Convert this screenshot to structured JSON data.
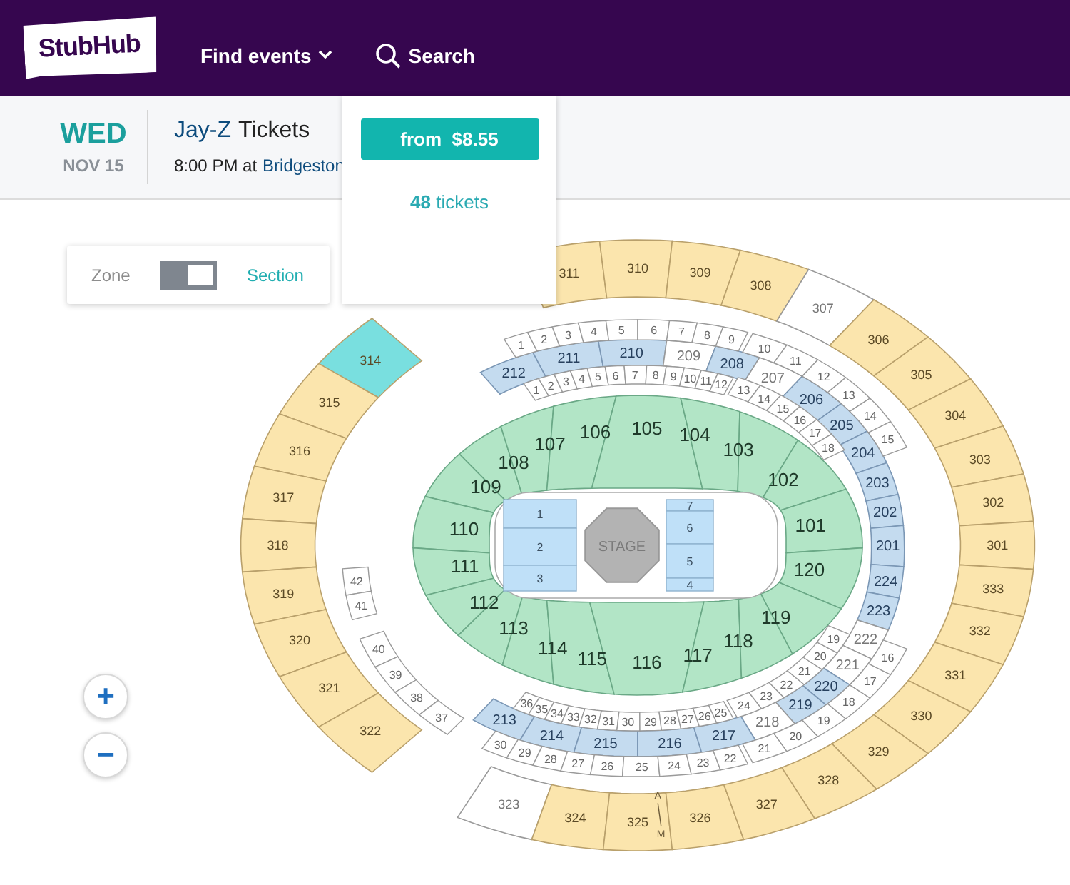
{
  "header": {
    "logo": "StubHub",
    "nav": [
      {
        "label": "Find events",
        "kind": "dropdown"
      },
      {
        "label": "Search",
        "kind": "search"
      }
    ]
  },
  "event": {
    "weekday": "WED",
    "date": "NOV 15",
    "artist": "Jay-Z",
    "title_suffix": "Tickets",
    "time_prefix": "8:00 PM at",
    "venue": "Bridgeston"
  },
  "popover": {
    "price_prefix": "from",
    "price": "$8.55",
    "tickets": "**48** tickets"
  },
  "view_toggle": {
    "left": "Zone",
    "right": "Section",
    "on": true
  },
  "zoom": [
    "+",
    "−"
  ],
  "map": {
    "upper_level": {
      "top": [
        {
          "label": "311",
          "available": true,
          "selected": false
        },
        {
          "label": "310",
          "available": true,
          "selected": false
        },
        {
          "label": "309",
          "available": true,
          "selected": false
        },
        {
          "label": "308",
          "available": true,
          "selected": false
        }
      ],
      "left": [
        {
          "label": "314",
          "available": true,
          "selected": true
        },
        {
          "label": "315",
          "available": true,
          "selected": false
        },
        {
          "label": "316",
          "available": true,
          "selected": false
        },
        {
          "label": "317",
          "available": true,
          "selected": false
        },
        {
          "label": "318",
          "available": true,
          "selected": false
        },
        {
          "label": "319",
          "available": true,
          "selected": false
        },
        {
          "label": "320",
          "available": true,
          "selected": false
        },
        {
          "label": "321",
          "available": true,
          "selected": false
        },
        {
          "label": "322",
          "available": true,
          "selected": false
        }
      ],
      "right": [
        {
          "label": "307",
          "available": false,
          "selected": false
        },
        {
          "label": "306",
          "available": true,
          "selected": false
        },
        {
          "label": "305",
          "available": true,
          "selected": false
        },
        {
          "label": "304",
          "available": true,
          "selected": false
        },
        {
          "label": "303",
          "available": true,
          "selected": false
        },
        {
          "label": "302",
          "available": true,
          "selected": false
        },
        {
          "label": "301",
          "available": true,
          "selected": false
        },
        {
          "label": "333",
          "available": true,
          "selected": false
        },
        {
          "label": "332",
          "available": true,
          "selected": false
        },
        {
          "label": "331",
          "available": true,
          "selected": false
        },
        {
          "label": "330",
          "available": true,
          "selected": false
        },
        {
          "label": "329",
          "available": true,
          "selected": false
        },
        {
          "label": "328",
          "available": true,
          "selected": false
        }
      ],
      "bottom": [
        {
          "label": "323",
          "available": false,
          "selected": false
        },
        {
          "label": "324",
          "available": true,
          "selected": false
        },
        {
          "label": "325",
          "available": true,
          "selected": false
        },
        {
          "label": "326",
          "available": true,
          "selected": false
        },
        {
          "label": "327",
          "available": true,
          "selected": false
        }
      ]
    },
    "mid_level": {
      "top": [
        {
          "label": "212",
          "available": true,
          "selected": false
        },
        {
          "label": "211",
          "available": true,
          "selected": false
        },
        {
          "label": "210",
          "available": true,
          "selected": false
        },
        {
          "label": "209",
          "available": false,
          "selected": false
        },
        {
          "label": "208",
          "available": true,
          "selected": false
        }
      ],
      "right": [
        {
          "label": "207",
          "available": false,
          "selected": false
        },
        {
          "label": "206",
          "available": true,
          "selected": false
        },
        {
          "label": "205",
          "available": true,
          "selected": false
        },
        {
          "label": "204",
          "available": true,
          "selected": false
        },
        {
          "label": "203",
          "available": true,
          "selected": false
        },
        {
          "label": "202",
          "available": true,
          "selected": false
        },
        {
          "label": "201",
          "available": true,
          "selected": false
        },
        {
          "label": "224",
          "available": true,
          "selected": false
        },
        {
          "label": "223",
          "available": true,
          "selected": false
        },
        {
          "label": "222",
          "available": false,
          "selected": false
        },
        {
          "label": "221",
          "available": false,
          "selected": false
        },
        {
          "label": "220",
          "available": true,
          "selected": false
        },
        {
          "label": "219",
          "available": true,
          "selected": false
        },
        {
          "label": "218",
          "available": false,
          "selected": false
        }
      ],
      "bottom": [
        {
          "label": "213",
          "available": true,
          "selected": false
        },
        {
          "label": "214",
          "available": true,
          "selected": false
        },
        {
          "label": "215",
          "available": true,
          "selected": false
        },
        {
          "label": "216",
          "available": true,
          "selected": false
        },
        {
          "label": "217",
          "available": true,
          "selected": false
        }
      ]
    },
    "row_blocks": [
      {
        "labels": [
          "1",
          "2",
          "3",
          "4",
          "5",
          "6",
          "7",
          "8",
          "9"
        ]
      },
      {
        "labels": [
          "1",
          "2",
          "3",
          "4",
          "5",
          "6",
          "7",
          "8",
          "9",
          "10",
          "11",
          "12"
        ]
      },
      {
        "labels": [
          "10",
          "11",
          "12",
          "13",
          "14",
          "15"
        ]
      },
      {
        "labels": [
          "13",
          "14",
          "15",
          "16",
          "17",
          "18"
        ]
      },
      {
        "labels": [
          "42",
          "41"
        ]
      },
      {
        "labels": [
          "40",
          "39",
          "38",
          "37"
        ]
      },
      {
        "labels": [
          "36",
          "35",
          "34",
          "33",
          "32",
          "31",
          "30",
          "29",
          "28",
          "27",
          "26",
          "25"
        ]
      },
      {
        "labels": [
          "24",
          "23",
          "22",
          "21",
          "20",
          "19"
        ]
      },
      {
        "labels": [
          "30",
          "29",
          "28",
          "27",
          "26",
          "25",
          "24",
          "23",
          "22"
        ]
      },
      {
        "labels": [
          "21",
          "20",
          "19",
          "18",
          "17",
          "16"
        ]
      }
    ],
    "lower_level": {
      "top": [
        {
          "label": "108",
          "available": true,
          "selected": false
        },
        {
          "label": "107",
          "available": true,
          "selected": false
        },
        {
          "label": "106",
          "available": true,
          "selected": false
        },
        {
          "label": "105",
          "available": true,
          "selected": false
        },
        {
          "label": "104",
          "available": true,
          "selected": false
        },
        {
          "label": "103",
          "available": true,
          "selected": false
        }
      ],
      "left": [
        {
          "label": "109",
          "available": true,
          "selected": false
        },
        {
          "label": "110",
          "available": true,
          "selected": false
        },
        {
          "label": "111",
          "available": true,
          "selected": false
        },
        {
          "label": "112",
          "available": true,
          "selected": false
        }
      ],
      "right": [
        {
          "label": "102",
          "available": true,
          "selected": false
        },
        {
          "label": "101",
          "available": true,
          "selected": false
        },
        {
          "label": "120",
          "available": true,
          "selected": false
        },
        {
          "label": "119",
          "available": true,
          "selected": false
        }
      ],
      "bottom": [
        {
          "label": "113",
          "available": true,
          "selected": false
        },
        {
          "label": "114",
          "available": true,
          "selected": false
        },
        {
          "label": "115",
          "available": true,
          "selected": false
        },
        {
          "label": "116",
          "available": true,
          "selected": false
        },
        {
          "label": "117",
          "available": true,
          "selected": false
        },
        {
          "label": "118",
          "available": true,
          "selected": false
        }
      ]
    },
    "floor": {
      "left": [
        {
          "label": "1",
          "available": true,
          "selected": false
        },
        {
          "label": "2",
          "available": true,
          "selected": false
        },
        {
          "label": "3",
          "available": true,
          "selected": false
        }
      ],
      "right": [
        {
          "label": "7",
          "available": true,
          "selected": false
        },
        {
          "label": "6",
          "available": true,
          "selected": false
        },
        {
          "label": "5",
          "available": true,
          "selected": false
        },
        {
          "label": "4",
          "available": true,
          "selected": false
        }
      ],
      "stage": "STAGE"
    },
    "row_marker": {
      "first": "A",
      "last": "M"
    }
  }
}
